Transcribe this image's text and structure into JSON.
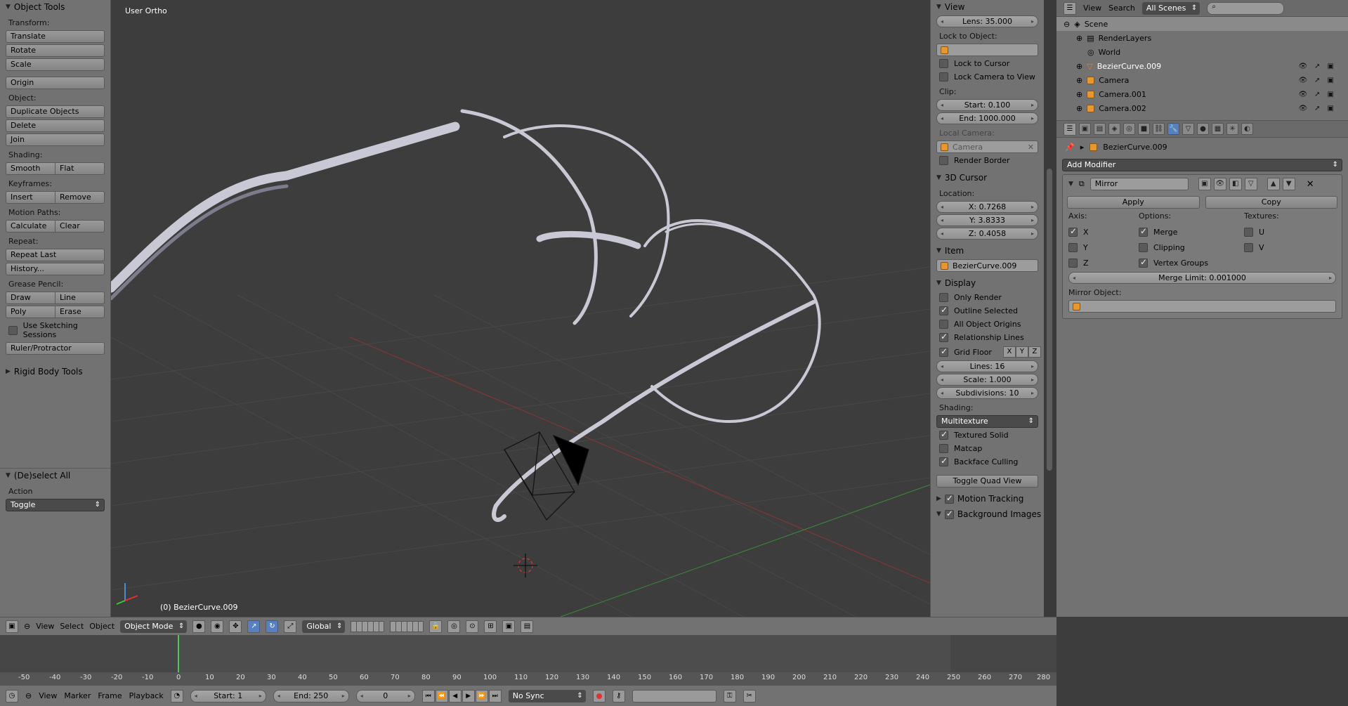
{
  "left_panel": {
    "object_tools_title": "Object Tools",
    "transform_label": "Transform:",
    "translate": "Translate",
    "rotate": "Rotate",
    "scale": "Scale",
    "origin": "Origin",
    "object_label": "Object:",
    "duplicate": "Duplicate Objects",
    "delete": "Delete",
    "join": "Join",
    "shading_label": "Shading:",
    "smooth": "Smooth",
    "flat": "Flat",
    "keyframes_label": "Keyframes:",
    "insert": "Insert",
    "remove": "Remove",
    "motion_paths_label": "Motion Paths:",
    "calculate": "Calculate",
    "clear": "Clear",
    "repeat_label": "Repeat:",
    "repeat_last": "Repeat Last",
    "history": "History...",
    "grease_pencil_label": "Grease Pencil:",
    "draw": "Draw",
    "line": "Line",
    "poly": "Poly",
    "erase": "Erase",
    "use_sketching": "Use Sketching Sessions",
    "ruler": "Ruler/Protractor",
    "rigid_body": "Rigid Body Tools",
    "deselect_all": "(De)select All",
    "action_label": "Action",
    "action_value": "Toggle"
  },
  "viewport": {
    "title": "User Ortho",
    "status": "(0) BezierCurve.009"
  },
  "right_panel": {
    "view_title": "View",
    "lens": "Lens: 35.000",
    "lock_to_object": "Lock to Object:",
    "lock_to_cursor": "Lock to Cursor",
    "lock_camera": "Lock Camera to View",
    "clip_label": "Clip:",
    "clip_start": "Start: 0.100",
    "clip_end": "End: 1000.000",
    "local_camera": "Local Camera:",
    "camera": "Camera",
    "render_border": "Render Border",
    "cursor_title": "3D Cursor",
    "location_label": "Location:",
    "x": "X: 0.7268",
    "y": "Y: 3.8333",
    "z": "Z: 0.4058",
    "item_title": "Item",
    "item_name": "BezierCurve.009",
    "display_title": "Display",
    "only_render": "Only Render",
    "outline_selected": "Outline Selected",
    "all_origins": "All Object Origins",
    "relationship_lines": "Relationship Lines",
    "grid_floor": "Grid Floor",
    "axis_x": "X",
    "axis_y": "Y",
    "axis_z": "Z",
    "lines": "Lines: 16",
    "scale": "Scale: 1.000",
    "subdivisions": "Subdivisions: 10",
    "shading_label": "Shading:",
    "shading_value": "Multitexture",
    "textured_solid": "Textured Solid",
    "matcap": "Matcap",
    "backface": "Backface Culling",
    "toggle_quad": "Toggle Quad View",
    "motion_tracking": "Motion Tracking",
    "background_images": "Background Images"
  },
  "outliner": {
    "view": "View",
    "search": "Search",
    "scenes": "All Scenes",
    "rows": [
      "Scene",
      "RenderLayers",
      "World",
      "BezierCurve.009",
      "Camera",
      "Camera.001",
      "Camera.002"
    ]
  },
  "properties": {
    "object_name": "BezierCurve.009",
    "add_modifier": "Add Modifier",
    "modifier_name": "Mirror",
    "apply": "Apply",
    "copy": "Copy",
    "axis_label": "Axis:",
    "options_label": "Options:",
    "textures_label": "Textures:",
    "ax_x": "X",
    "ax_y": "Y",
    "ax_z": "Z",
    "merge": "Merge",
    "clipping": "Clipping",
    "vertex_groups": "Vertex Groups",
    "tex_u": "U",
    "tex_v": "V",
    "merge_limit": "Merge Limit: 0.001000",
    "mirror_object": "Mirror Object:"
  },
  "toolbar_3d": {
    "view": "View",
    "select": "Select",
    "object": "Object",
    "mode": "Object Mode",
    "orientation": "Global"
  },
  "timeline": {
    "ticks": [
      "-50",
      "-40",
      "-30",
      "-20",
      "-10",
      "0",
      "10",
      "20",
      "30",
      "40",
      "50",
      "60",
      "70",
      "80",
      "90",
      "100",
      "110",
      "120",
      "130",
      "140",
      "150",
      "160",
      "170",
      "180",
      "190",
      "200",
      "210",
      "220",
      "230",
      "240",
      "250",
      "260",
      "270",
      "280"
    ]
  },
  "footer": {
    "view": "View",
    "marker": "Marker",
    "frame": "Frame",
    "playback": "Playback",
    "start": "Start: 1",
    "end": "End: 250",
    "current": "0",
    "sync": "No Sync"
  },
  "colors": {
    "accent": "#5680c2",
    "object_orange": "#e8962e",
    "frame_green": "#3fd04f"
  }
}
